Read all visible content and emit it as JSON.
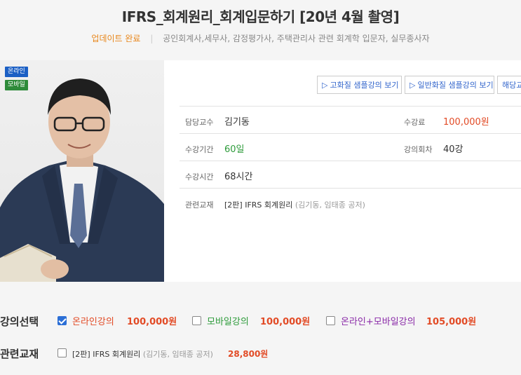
{
  "header": {
    "title": "IFRS_회계원리_회계입문하기 [20년 4월 촬영]",
    "update": "업데이트 완료",
    "separator": "|",
    "audience": "공인회계사,세무사, 감정평가사, 주택관리사 관련 회계학 입문자, 실무종사자"
  },
  "badges": {
    "online": "온라인",
    "mobile": "모바일"
  },
  "buttons": {
    "hd_sample": "고화질 샘플강의 보기",
    "sd_sample": "일반화질 샘플강의 보기",
    "book": "해당교",
    "play_icon": "▷"
  },
  "details": {
    "professor_label": "담당교수",
    "professor": "김기동",
    "fee_label": "수강료",
    "fee": "100,000원",
    "period_label": "수강기간",
    "period": "60일",
    "lectures_label": "강의회차",
    "lectures": "40강",
    "hours_label": "수강시간",
    "hours": "68시간",
    "textbook_label": "관련교재",
    "textbook": "[2판] IFRS 회계원리",
    "textbook_authors": "(김기동, 임태종 공저)"
  },
  "options": {
    "label": "강의선택",
    "items": [
      {
        "name": "온라인강의",
        "price": "100,000원",
        "checked": true,
        "color": "#e24b26"
      },
      {
        "name": "모바일강의",
        "price": "100,000원",
        "checked": false,
        "color": "#2d9b3a"
      },
      {
        "name": "온라인+모바일강의",
        "price": "105,000원",
        "checked": false,
        "color": "#8a2aa8"
      }
    ]
  },
  "books": {
    "label": "관련교재",
    "item_name": "[2판] IFRS 회계원리",
    "item_authors": "(김기동, 임태종 공저)",
    "item_price": "28,800원",
    "checked": false
  },
  "colors": {
    "accent_orange": "#e8861a",
    "price_red": "#e24b26",
    "link_blue": "#3366cc"
  }
}
